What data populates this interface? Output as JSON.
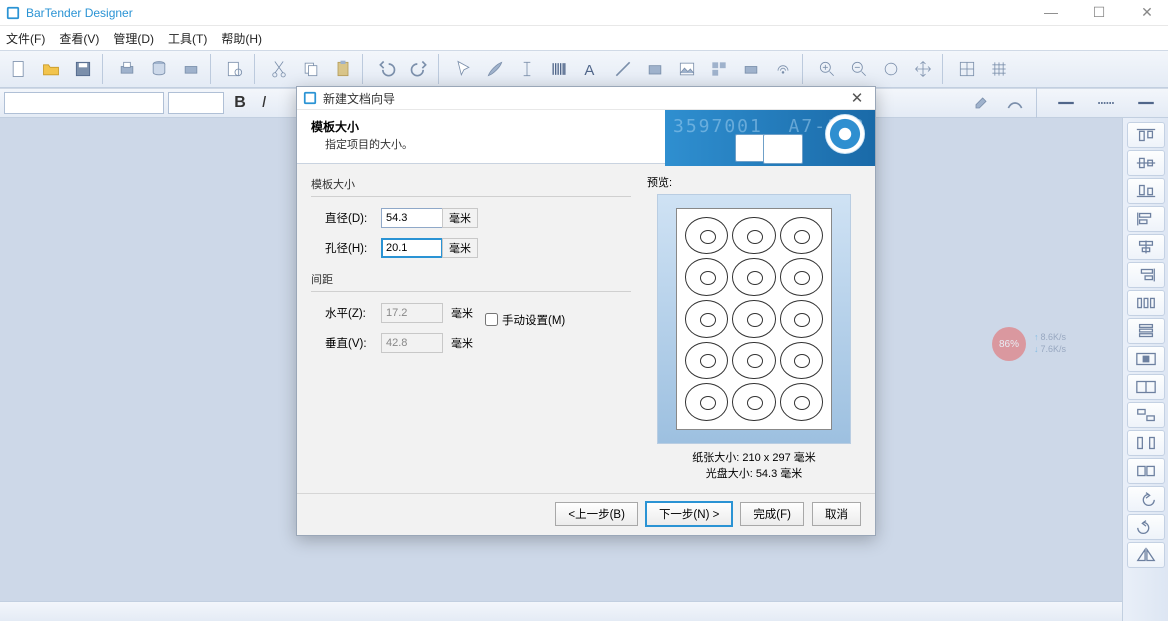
{
  "app": {
    "title": "BarTender Designer"
  },
  "menu": {
    "file": "文件(F)",
    "view": "查看(V)",
    "manage": "管理(D)",
    "tools": "工具(T)",
    "help": "帮助(H)"
  },
  "format": {
    "bold": "B",
    "italic": "I"
  },
  "dialog": {
    "title": "新建文档向导",
    "heading": "模板大小",
    "sub": "指定项目的大小。",
    "section_size": "模板大小",
    "section_gap": "间距",
    "diameter_label": "直径(D):",
    "diameter_value": "54.3",
    "hole_label": "孔径(H):",
    "hole_value": "20.1",
    "horiz_label": "水平(Z):",
    "horiz_value": "17.2",
    "vert_label": "垂直(V):",
    "vert_value": "42.8",
    "unit": "毫米",
    "manual_label": "手动设置(M)",
    "preview_label": "预览:",
    "paper_caption": "纸张大小:  210 x 297 毫米",
    "disc_caption": "光盘大小:  54.3 毫米",
    "btn_back": "<上一步(B)",
    "btn_next": "下一步(N) >",
    "btn_finish": "完成(F)",
    "btn_cancel": "取消"
  },
  "net": {
    "pct": "86%",
    "up": "8.6K/s",
    "down": "7.6K/s"
  }
}
